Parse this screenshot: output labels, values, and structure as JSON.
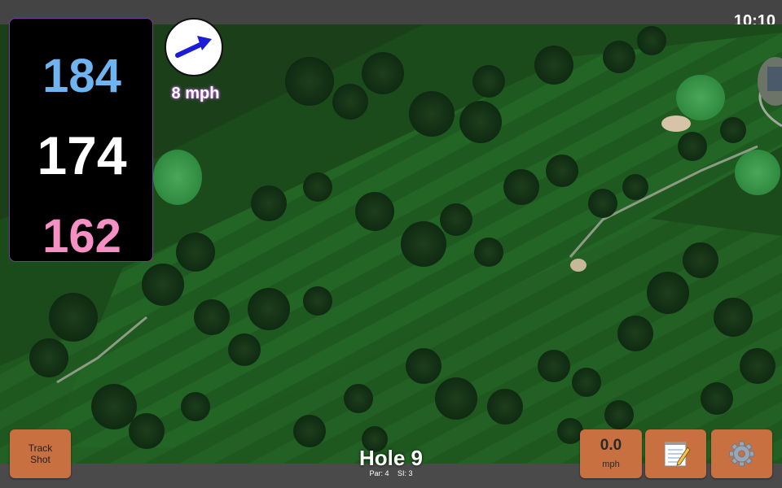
{
  "status": {
    "time": "10:10"
  },
  "distances": {
    "back": "184",
    "middle": "174",
    "front": "162"
  },
  "wind": {
    "speed_label": "8 mph",
    "arrow_icon": "wind-direction-arrow-icon"
  },
  "buttons": {
    "track_shot_line1": "Track",
    "track_shot_line2": "Shot",
    "speed_value": "0.0",
    "speed_unit": "mph",
    "notes_icon": "notepad-icon",
    "settings_icon": "gear-icon"
  },
  "hole": {
    "title": "Hole 9",
    "par_label": "Par: 4",
    "si_label": "SI: 3"
  },
  "colors": {
    "back": "#6fb4f0",
    "middle": "#ffffff",
    "front": "#f68fc3",
    "button": "#c8703f"
  }
}
